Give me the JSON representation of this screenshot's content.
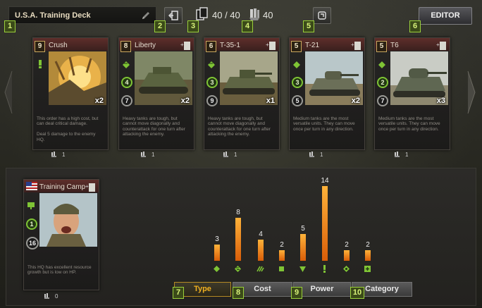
{
  "deck": {
    "name": "U.S.A. Training Deck",
    "card_count": "40 / 40",
    "resource_count": "40",
    "editor_label": "EDITOR"
  },
  "hints": {
    "h1": "1",
    "h2": "2",
    "h3": "3",
    "h4": "4",
    "h5": "5",
    "h6": "6",
    "h7": "7",
    "h8": "8",
    "h9": "9",
    "h10": "10"
  },
  "cards": [
    {
      "cost": "9",
      "name": "Crush",
      "count": "x2",
      "power": "",
      "hp": "",
      "desc": "This order has a high cost, but can deal critical damage.\n\nDeal 5 damage to the enemy HQ.",
      "below": "1"
    },
    {
      "cost": "8",
      "name": "Liberty",
      "count": "x2",
      "power": "4",
      "hp": "7",
      "desc": "Heavy tanks are tough, but cannot move diagonally and counterattack for one turn after attacking the enemy.",
      "below": "1"
    },
    {
      "cost": "6",
      "name": "T-35-1",
      "count": "x1",
      "power": "3",
      "hp": "9",
      "desc": "Heavy tanks are tough, but cannot move diagonally and counterattack for one turn after attacking the enemy.",
      "below": "1"
    },
    {
      "cost": "5",
      "name": "T-21",
      "count": "x2",
      "power": "3",
      "hp": "5",
      "desc": "Medium tanks are the most versatile units. They can move once per turn in any direction.",
      "below": "1"
    },
    {
      "cost": "5",
      "name": "T6",
      "count": "x3",
      "power": "2",
      "hp": "7",
      "desc": "Medium tanks are the most versatile units. They can move once per turn in any direction.",
      "below": "1"
    }
  ],
  "hq": {
    "name": "Training Camp",
    "power": "1",
    "hp": "16",
    "desc": "This HQ has excellent resource growth but is low on HP.",
    "below": "0"
  },
  "chart_data": {
    "type": "bar",
    "categories": [
      "medium-tank",
      "heavy-tank",
      "light-tank",
      "tank-destroyer",
      "artillery",
      "order",
      "hq-ability",
      "special"
    ],
    "values": [
      3,
      8,
      4,
      2,
      5,
      14,
      2,
      2
    ],
    "ylim": [
      0,
      14
    ],
    "title": "",
    "xlabel": "",
    "ylabel": "",
    "labels": [
      "3",
      "8",
      "4",
      "2",
      "5",
      "14",
      "2",
      "2"
    ],
    "icons": [
      "medium-tank-icon",
      "heavy-tank-icon",
      "light-tank-icon",
      "tank-destroyer-icon",
      "artillery-icon",
      "order-icon",
      "hq-icon",
      "special-icon"
    ]
  },
  "tabs": [
    {
      "label": "Type",
      "active": true
    },
    {
      "label": "Cost",
      "active": false
    },
    {
      "label": "Power",
      "active": false
    },
    {
      "label": "Category",
      "active": false
    }
  ],
  "colors": {
    "accent": "#9ad03a",
    "bar_top": "#ffb33a",
    "bar_bottom": "#d95d08",
    "active_tab": "#f0b020"
  }
}
